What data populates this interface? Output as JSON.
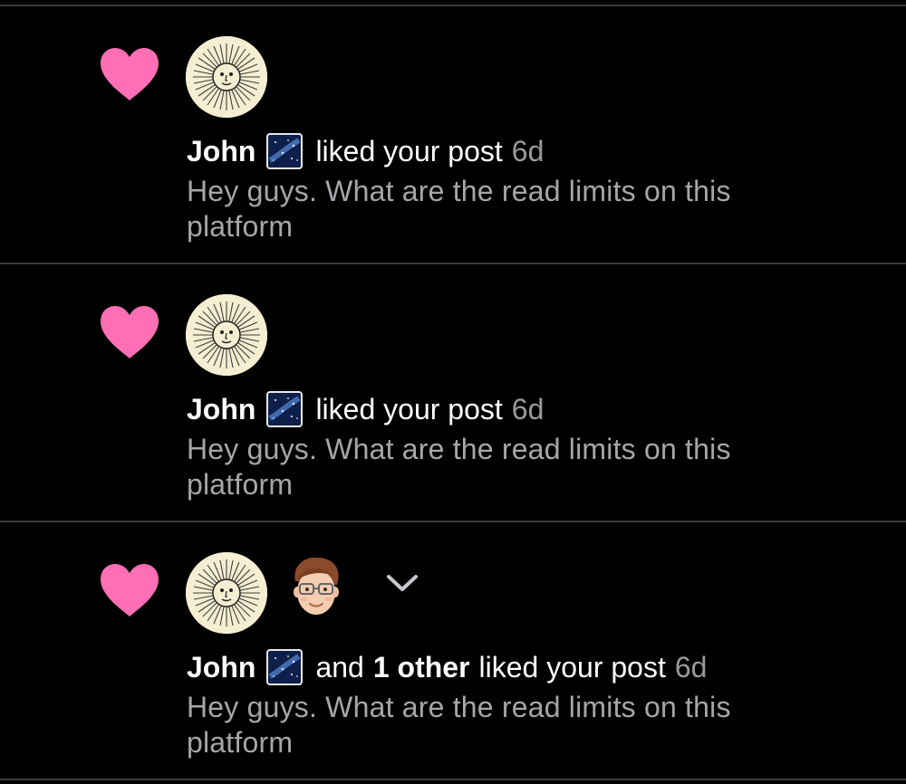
{
  "notifications": [
    {
      "user": "John",
      "user_badge_icon": "starry-night-badge-icon",
      "action": "liked your post",
      "time": "6d",
      "post_snippet": "Hey guys. What are the read limits on this platform",
      "avatars": [
        "sun-face-avatar"
      ]
    },
    {
      "user": "John",
      "user_badge_icon": "starry-night-badge-icon",
      "action": "liked your post",
      "time": "6d",
      "post_snippet": "Hey guys. What are the read limits on this platform",
      "avatars": [
        "sun-face-avatar"
      ]
    },
    {
      "user": "John",
      "user_badge_icon": "starry-night-badge-icon",
      "connector": "and",
      "others": "1 other",
      "action": "liked your post",
      "time": "6d",
      "post_snippet": "Hey guys. What are the read limits on this platform",
      "avatars": [
        "sun-face-avatar",
        "memoji-avatar"
      ],
      "expand_icon": "chevron-down-icon"
    }
  ],
  "colors": {
    "background": "#000000",
    "heart": "#ff6fb5",
    "divider": "#3a3a3c",
    "secondary_text": "#a6a6aa",
    "timestamp": "#9a9a9e"
  }
}
